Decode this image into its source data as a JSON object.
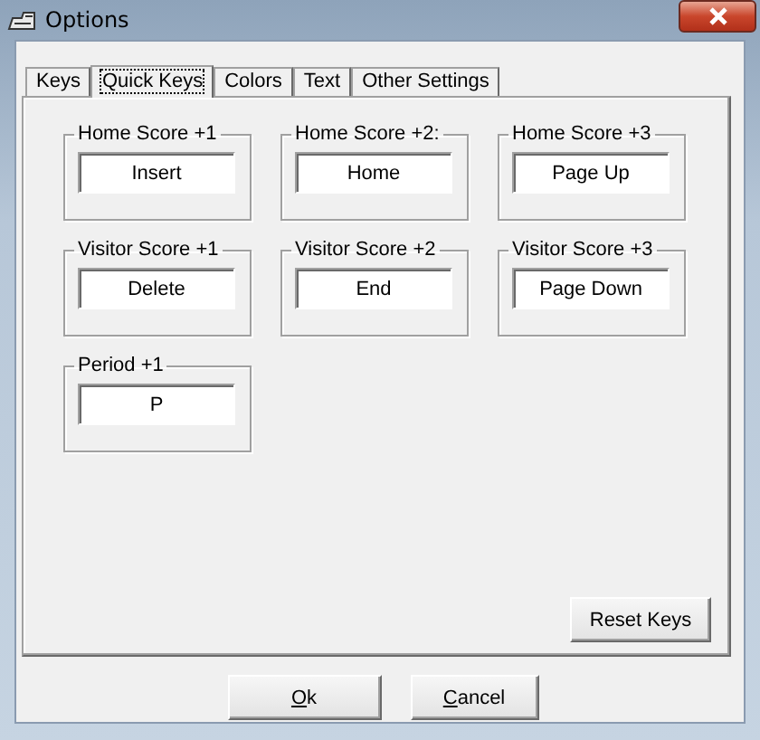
{
  "window": {
    "title": "Options"
  },
  "tabs": [
    {
      "label": "Keys",
      "selected": false
    },
    {
      "label": "Quick Keys",
      "selected": true
    },
    {
      "label": "Colors",
      "selected": false
    },
    {
      "label": "Text",
      "selected": false
    },
    {
      "label": "Other Settings",
      "selected": false
    }
  ],
  "key_groups": [
    {
      "label": "Home Score +1",
      "value": "Insert"
    },
    {
      "label": "Home Score +2:",
      "value": "Home"
    },
    {
      "label": "Home Score +3",
      "value": "Page Up"
    },
    {
      "label": "Visitor Score +1",
      "value": "Delete"
    },
    {
      "label": "Visitor Score +2",
      "value": "End"
    },
    {
      "label": "Visitor Score +3",
      "value": "Page Down"
    },
    {
      "label": "Period +1",
      "value": "P"
    }
  ],
  "reset_button": "Reset Keys",
  "buttons": [
    {
      "mnemonic": "O",
      "rest": "k"
    },
    {
      "mnemonic": "C",
      "rest": "ancel"
    }
  ]
}
